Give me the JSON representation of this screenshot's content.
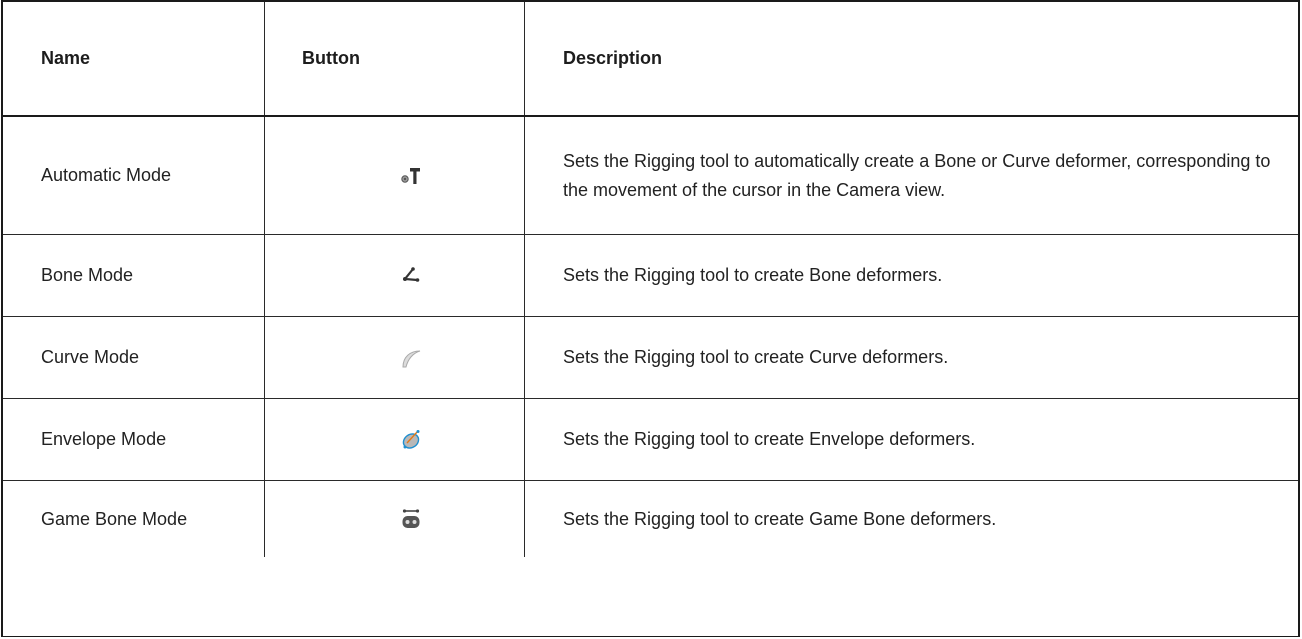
{
  "table": {
    "headers": {
      "name": "Name",
      "button": "Button",
      "description": "Description"
    },
    "rows": [
      {
        "name": "Automatic Mode",
        "icon": "automatic-mode-icon",
        "description": "Sets the Rigging tool to automatically create a Bone or Curve deformer, corresponding to the movement of the cursor in the Camera view."
      },
      {
        "name": "Bone Mode",
        "icon": "bone-mode-icon",
        "description": "Sets the Rigging tool to create Bone deformers."
      },
      {
        "name": "Curve Mode",
        "icon": "curve-mode-icon",
        "description": "Sets the Rigging tool to create Curve deformers."
      },
      {
        "name": "Envelope Mode",
        "icon": "envelope-mode-icon",
        "description": "Sets the Rigging tool to create Envelope deformers."
      },
      {
        "name": "Game Bone Mode",
        "icon": "game-bone-mode-icon",
        "description": "Sets the Rigging tool to create Game Bone deformers."
      }
    ]
  }
}
